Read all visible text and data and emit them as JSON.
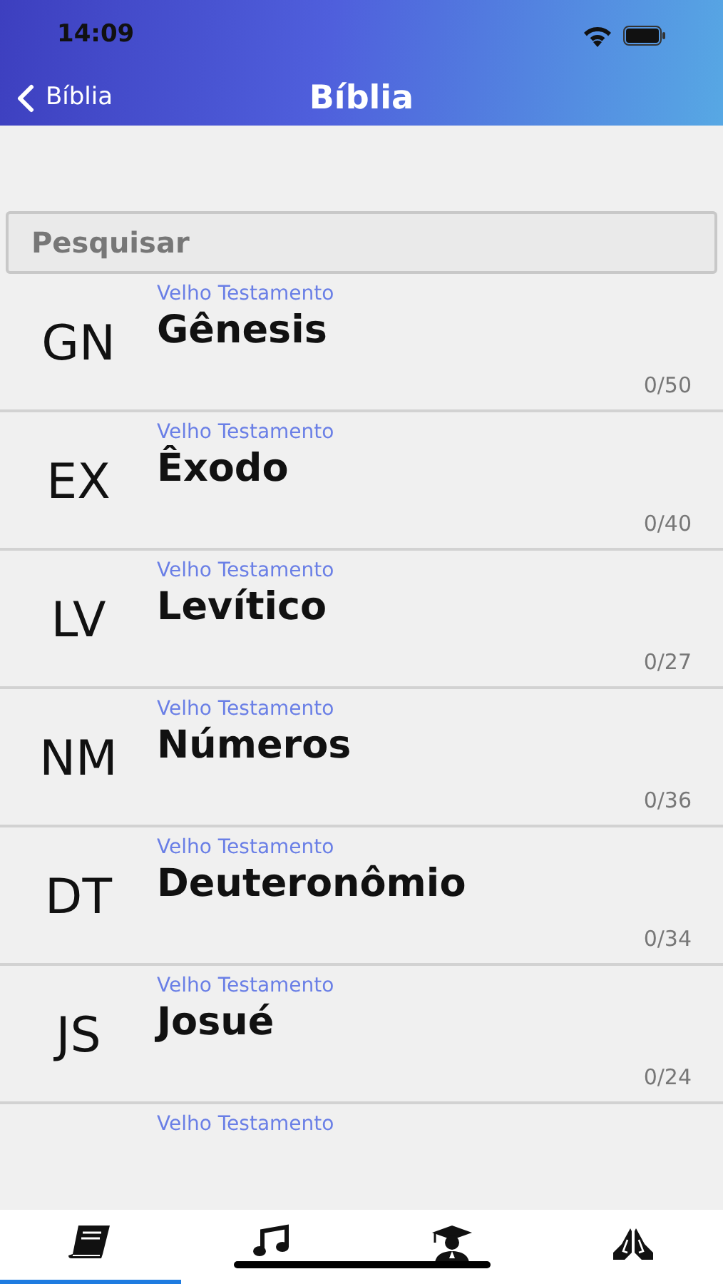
{
  "status_bar": {
    "time": "14:09"
  },
  "nav": {
    "back": "Bíblia",
    "title": "Bíblia"
  },
  "search": {
    "placeholder": "Pesquisar"
  },
  "books": [
    {
      "kind": "full",
      "abbr": "GN",
      "testament": "Velho Testamento",
      "name": "Gênesis",
      "progress": "0/50"
    },
    {
      "kind": "full",
      "abbr": "EX",
      "testament": "Velho Testamento",
      "name": "Êxodo",
      "progress": "0/40"
    },
    {
      "kind": "full",
      "abbr": "LV",
      "testament": "Velho Testamento",
      "name": "Levítico",
      "progress": "0/27"
    },
    {
      "kind": "full",
      "abbr": "NM",
      "testament": "Velho Testamento",
      "name": "Números",
      "progress": "0/36"
    },
    {
      "kind": "full",
      "abbr": "DT",
      "testament": "Velho Testamento",
      "name": "Deuteronômio",
      "progress": "0/34"
    },
    {
      "kind": "full",
      "abbr": "JS",
      "testament": "Velho Testamento",
      "name": "Josué",
      "progress": "0/24"
    },
    {
      "kind": "partial",
      "testament": "Velho Testamento"
    }
  ],
  "tabs": [
    {
      "selected": true
    },
    {
      "selected": false
    },
    {
      "selected": false
    },
    {
      "selected": false
    }
  ]
}
